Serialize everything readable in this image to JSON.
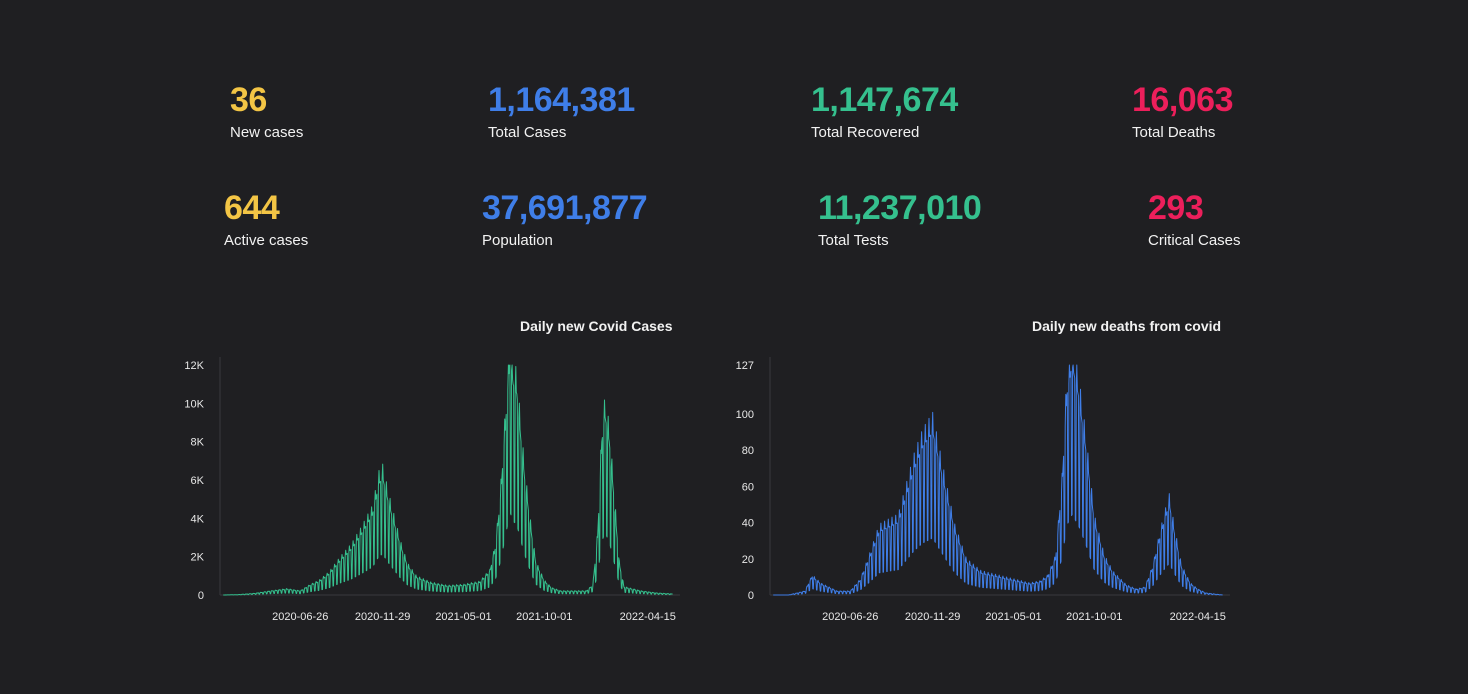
{
  "stats": {
    "new_cases": {
      "value": "36",
      "label": "New cases"
    },
    "total_cases": {
      "value": "1,164,381",
      "label": "Total Cases"
    },
    "total_recovered": {
      "value": "1,147,674",
      "label": "Total Recovered"
    },
    "total_deaths": {
      "value": "16,063",
      "label": "Total Deaths"
    },
    "active_cases": {
      "value": "644",
      "label": "Active cases"
    },
    "population": {
      "value": "37,691,877",
      "label": "Population"
    },
    "total_tests": {
      "value": "11,237,010",
      "label": "Total Tests"
    },
    "critical_cases": {
      "value": "293",
      "label": "Critical Cases"
    }
  },
  "colors": {
    "yellow": "#f3c545",
    "blue": "#3f7ee8",
    "green": "#35c08e",
    "red": "#ec1f5b",
    "background": "#1f1f22"
  },
  "chart_data": [
    {
      "type": "line",
      "title": "Daily new Covid Cases",
      "color": "#35c08e",
      "xlabel": "",
      "ylabel": "",
      "ylim": [
        0,
        12000
      ],
      "yticks": [
        0,
        2000,
        4000,
        6000,
        8000,
        10000,
        12000
      ],
      "ytick_labels": [
        "0",
        "2K",
        "4K",
        "6K",
        "8K",
        "10K",
        "12K"
      ],
      "xticks": [
        "2020-06-26",
        "2020-11-29",
        "2021-05-01",
        "2021-10-01",
        "2022-04-15"
      ],
      "xlim": [
        "2020-01-26",
        "2022-06-15"
      ],
      "series": [
        {
          "x": [
            "2020-02-01",
            "2020-03-01",
            "2020-04-01",
            "2020-05-01",
            "2020-06-01",
            "2020-06-26",
            "2020-07-15",
            "2020-08-01",
            "2020-08-20",
            "2020-09-10",
            "2020-10-01",
            "2020-10-20",
            "2020-11-10",
            "2020-11-22",
            "2020-11-29",
            "2020-12-10",
            "2020-12-20",
            "2021-01-01",
            "2021-01-15",
            "2021-02-01",
            "2021-03-01",
            "2021-04-01",
            "2021-05-01",
            "2021-06-01",
            "2021-06-20",
            "2021-07-01",
            "2021-07-10",
            "2021-07-20",
            "2021-07-28",
            "2021-08-03",
            "2021-08-10",
            "2021-08-18",
            "2021-08-25",
            "2021-09-05",
            "2021-09-15",
            "2021-10-01",
            "2021-10-15",
            "2021-11-01",
            "2021-12-01",
            "2021-12-20",
            "2022-01-01",
            "2022-01-10",
            "2022-01-18",
            "2022-01-24",
            "2022-02-01",
            "2022-02-10",
            "2022-02-20",
            "2022-03-01",
            "2022-04-01",
            "2022-05-01",
            "2022-06-01"
          ],
          "values": [
            0,
            20,
            80,
            200,
            300,
            200,
            500,
            700,
            1100,
            1800,
            2400,
            3200,
            4200,
            5800,
            6100,
            4800,
            3800,
            2600,
            1500,
            900,
            600,
            450,
            500,
            650,
            1200,
            2500,
            5000,
            9000,
            12400,
            11000,
            10500,
            8000,
            6000,
            3500,
            1600,
            700,
            350,
            200,
            200,
            200,
            500,
            3000,
            8000,
            9300,
            8000,
            5000,
            1600,
            400,
            200,
            100,
            50
          ]
        }
      ]
    },
    {
      "type": "line",
      "title": "Daily new deaths from covid",
      "color": "#3f7ee8",
      "xlabel": "",
      "ylabel": "",
      "ylim": [
        0,
        127
      ],
      "yticks": [
        0,
        20,
        40,
        60,
        80,
        100,
        127
      ],
      "ytick_labels": [
        "0",
        "20",
        "40",
        "60",
        "80",
        "100",
        "127"
      ],
      "xticks": [
        "2020-06-26",
        "2020-11-29",
        "2021-05-01",
        "2021-10-01",
        "2022-04-15"
      ],
      "xlim": [
        "2020-01-26",
        "2022-06-15"
      ],
      "series": [
        {
          "x": [
            "2020-02-01",
            "2020-03-01",
            "2020-04-01",
            "2020-04-15",
            "2020-05-01",
            "2020-06-01",
            "2020-06-26",
            "2020-07-15",
            "2020-08-01",
            "2020-08-20",
            "2020-09-10",
            "2020-09-25",
            "2020-10-10",
            "2020-10-25",
            "2020-11-10",
            "2020-11-29",
            "2020-12-10",
            "2020-12-25",
            "2021-01-10",
            "2021-02-01",
            "2021-03-01",
            "2021-04-01",
            "2021-05-01",
            "2021-06-01",
            "2021-06-20",
            "2021-07-05",
            "2021-07-20",
            "2021-08-01",
            "2021-08-10",
            "2021-08-20",
            "2021-09-01",
            "2021-09-15",
            "2021-10-01",
            "2021-10-20",
            "2021-11-05",
            "2021-12-01",
            "2021-12-20",
            "2022-01-05",
            "2022-01-20",
            "2022-02-01",
            "2022-02-10",
            "2022-02-20",
            "2022-03-01",
            "2022-03-15",
            "2022-04-01",
            "2022-04-15",
            "2022-05-01",
            "2022-06-01"
          ],
          "values": [
            0,
            0,
            2,
            10,
            6,
            2,
            2,
            8,
            20,
            35,
            38,
            40,
            55,
            70,
            82,
            90,
            75,
            55,
            35,
            18,
            12,
            10,
            8,
            6,
            7,
            10,
            20,
            60,
            110,
            127,
            110,
            80,
            40,
            20,
            12,
            5,
            3,
            4,
            15,
            30,
            40,
            50,
            35,
            15,
            6,
            3,
            1,
            0
          ]
        }
      ]
    }
  ]
}
